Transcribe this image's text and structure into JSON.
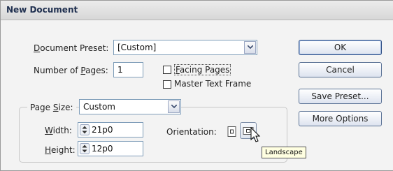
{
  "window": {
    "title": "New Document"
  },
  "preset": {
    "label_pre": "",
    "label_u": "D",
    "label_post": "ocument Preset:",
    "value": "[Custom]"
  },
  "pages": {
    "label_pre": "Number of ",
    "label_u": "P",
    "label_post": "ages:",
    "value": "1"
  },
  "facing_pages": {
    "label_pre": "",
    "label_u": "F",
    "label_post": "acing Pages",
    "checked": false
  },
  "master_text_frame": {
    "label": "Master Text Frame",
    "checked": false
  },
  "page_size": {
    "label_pre": "Page ",
    "label_u": "S",
    "label_post": "ize:",
    "value": "Custom"
  },
  "width": {
    "label_pre": "",
    "label_u": "W",
    "label_post": "idth:",
    "value": "21p0"
  },
  "height": {
    "label_pre": "",
    "label_u": "H",
    "label_post": "eight:",
    "value": "12p0"
  },
  "orientation": {
    "label": "Orientation:",
    "selected": "landscape"
  },
  "buttons": {
    "ok": "OK",
    "cancel": "Cancel",
    "save_preset": "Save Preset...",
    "more_options": "More Options"
  },
  "tooltip": "Landscape"
}
